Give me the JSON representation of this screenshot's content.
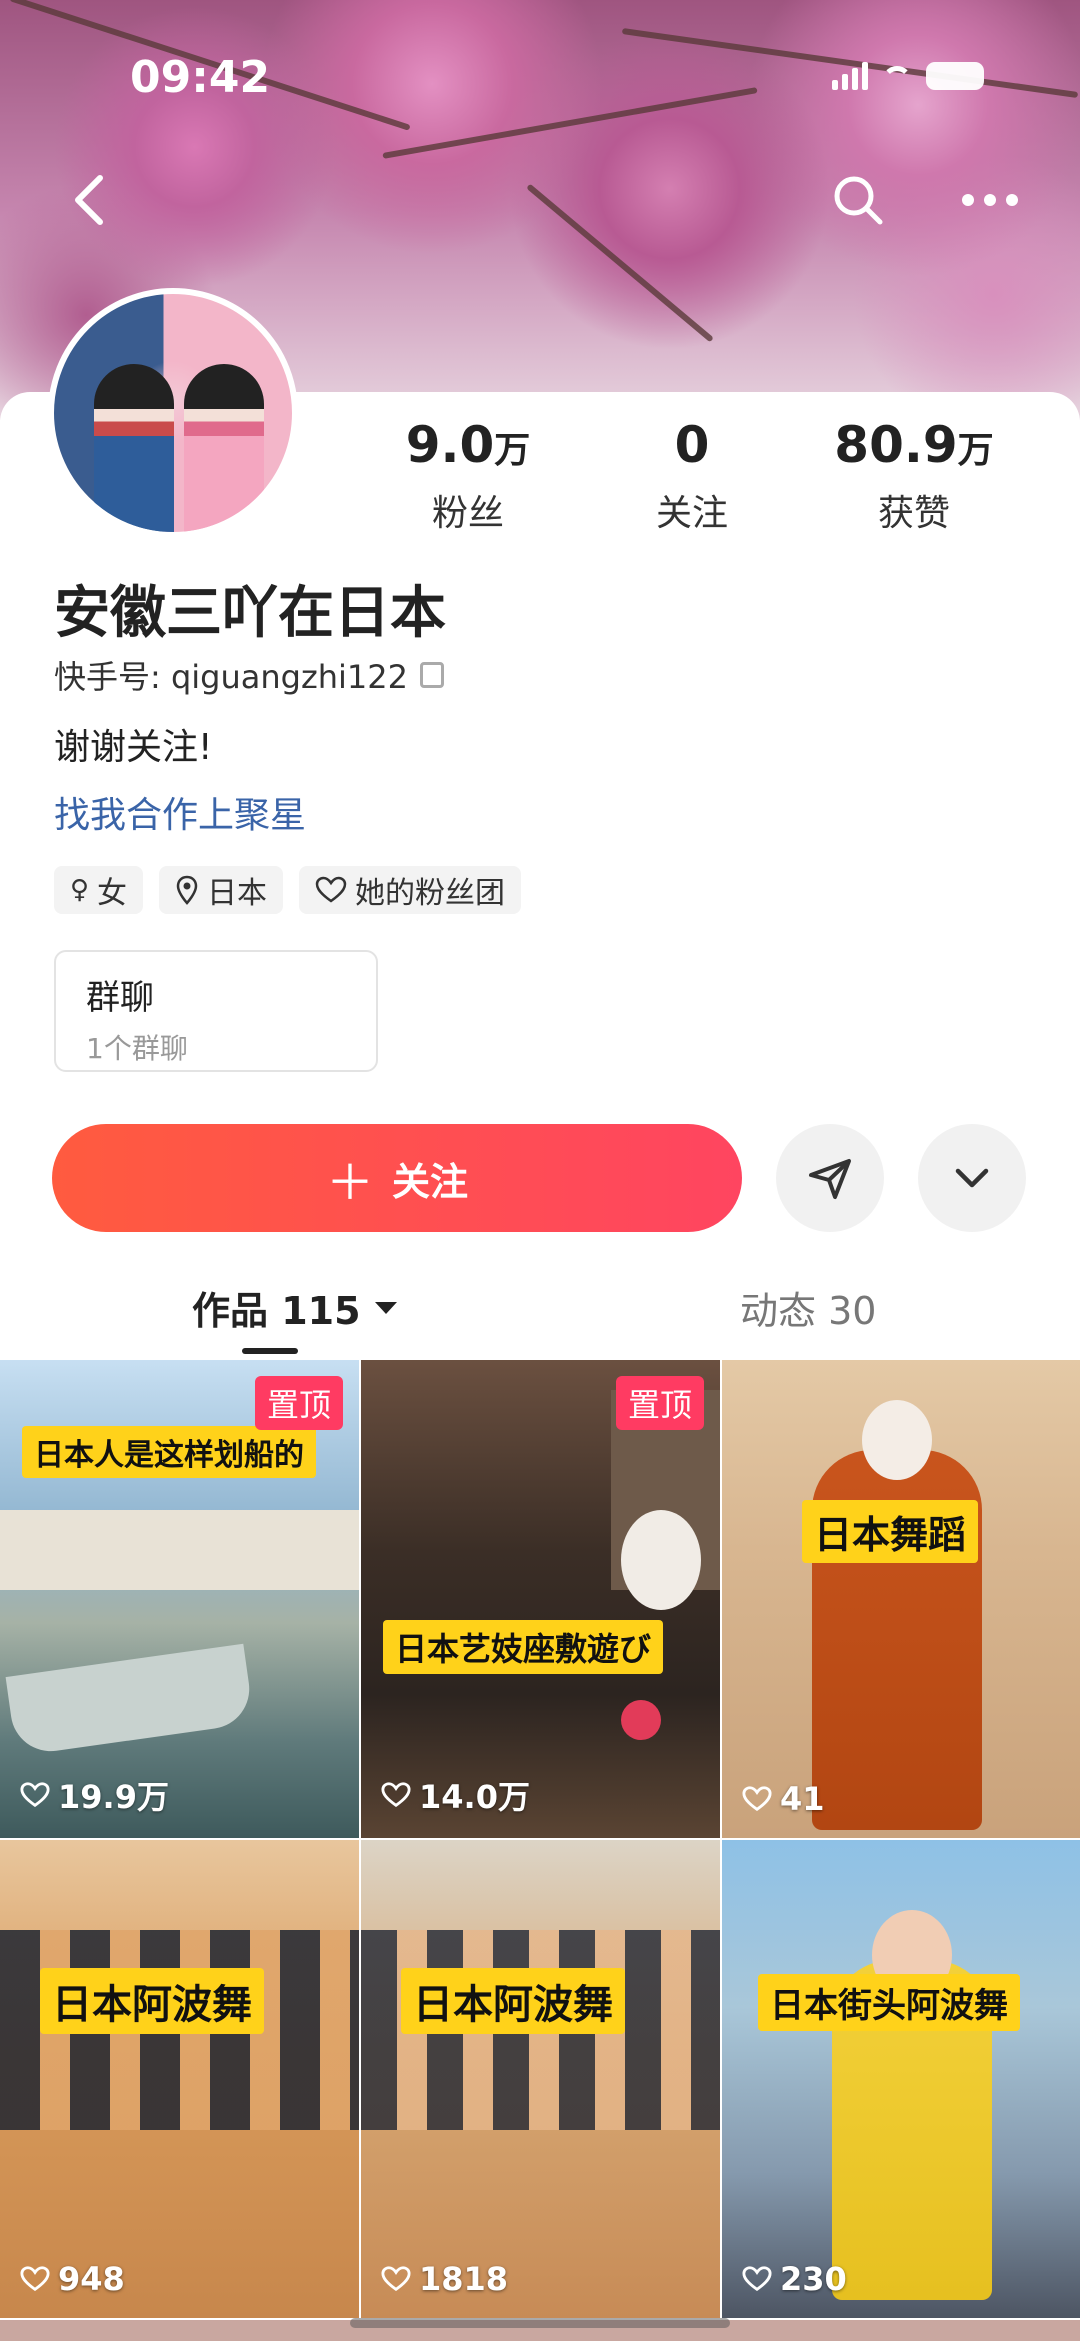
{
  "status_bar": {
    "time": "09:42"
  },
  "profile": {
    "name": "安徽三吖在日本",
    "kuaishou_id": "快手号: qiguangzhi122",
    "bio": "谢谢关注!",
    "link": "找我合作上聚星",
    "tags": [
      {
        "icon": "female-icon",
        "label": "女"
      },
      {
        "icon": "location-icon",
        "label": "日本"
      },
      {
        "icon": "heart-link-icon",
        "label": "她的粉丝团"
      }
    ],
    "stats": [
      {
        "num": "9.0",
        "unit": "万",
        "label": "粉丝"
      },
      {
        "num": "0",
        "unit": "",
        "label": "关注"
      },
      {
        "num": "80.9",
        "unit": "万",
        "label": "获赞"
      }
    ],
    "group": {
      "title": "群聊",
      "subtitle": "1个群聊"
    }
  },
  "actions": {
    "follow_label": "关注"
  },
  "tabs": [
    {
      "label": "作品 115",
      "active": true
    },
    {
      "label": "动态 30",
      "active": false
    }
  ],
  "videos": [
    {
      "caption": "日本人是这样划船的",
      "pin": "置顶",
      "likes": "19.9万"
    },
    {
      "caption": "日本艺妓座敷遊び",
      "pin": "置顶",
      "likes": "14.0万"
    },
    {
      "caption": "日本舞蹈",
      "pin": "",
      "likes": "41"
    },
    {
      "caption": "日本阿波舞",
      "pin": "",
      "likes": "948"
    },
    {
      "caption": "日本阿波舞",
      "pin": "",
      "likes": "1818"
    },
    {
      "caption": "日本街头阿波舞",
      "pin": "",
      "likes": "230"
    }
  ],
  "colors": {
    "follow_start": "#ff5b3f",
    "follow_end": "#ff4560",
    "pin": "#ff3b62",
    "caption_bg": "#ffd21a",
    "link": "#3a64a8"
  }
}
